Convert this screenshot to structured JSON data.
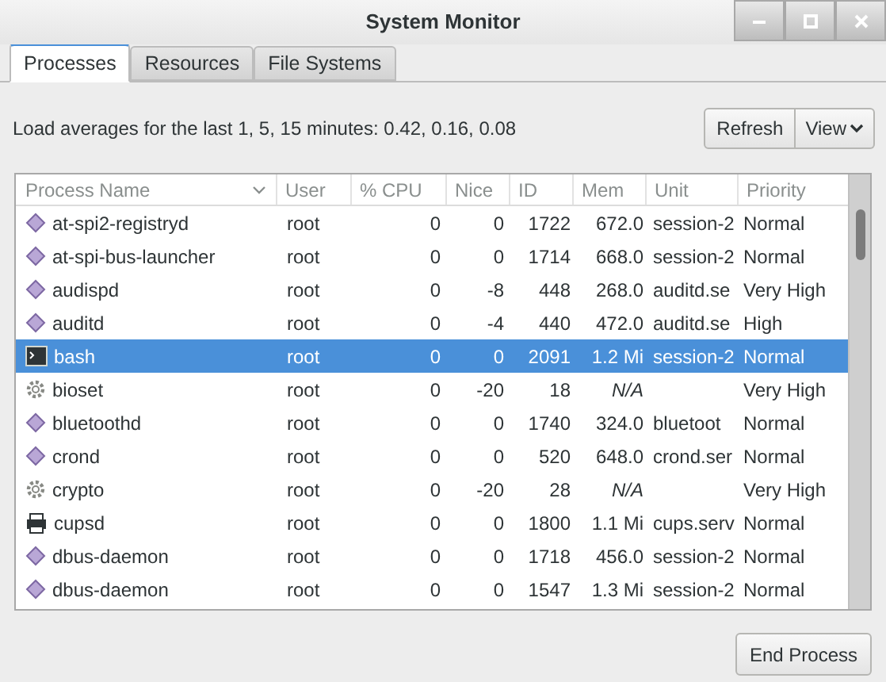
{
  "window": {
    "title": "System Monitor"
  },
  "tabs": [
    {
      "label": "Processes",
      "selected": true
    },
    {
      "label": "Resources",
      "selected": false
    },
    {
      "label": "File Systems",
      "selected": false
    }
  ],
  "load_averages": "Load averages for the last 1, 5, 15 minutes: 0.42, 0.16, 0.08",
  "buttons": {
    "refresh": "Refresh",
    "view": "View",
    "end_process": "End Process"
  },
  "table": {
    "columns": [
      "Process Name",
      "User",
      "% CPU",
      "Nice",
      "ID",
      "Mem",
      "Unit",
      "Priority"
    ],
    "rows": [
      {
        "kind": "daemon",
        "selected": false,
        "cells": [
          "at-spi2-registryd",
          "root",
          "0",
          "0",
          "1722",
          "672.0",
          "session-2",
          "Normal"
        ]
      },
      {
        "kind": "daemon",
        "selected": false,
        "cells": [
          "at-spi-bus-launcher",
          "root",
          "0",
          "0",
          "1714",
          "668.0",
          "session-2",
          "Normal"
        ]
      },
      {
        "kind": "daemon",
        "selected": false,
        "cells": [
          "audispd",
          "root",
          "0",
          "-8",
          "448",
          "268.0",
          "auditd.se",
          "Very High"
        ]
      },
      {
        "kind": "daemon",
        "selected": false,
        "cells": [
          "auditd",
          "root",
          "0",
          "-4",
          "440",
          "472.0",
          "auditd.se",
          "High"
        ]
      },
      {
        "kind": "terminal",
        "selected": true,
        "cells": [
          "bash",
          "root",
          "0",
          "0",
          "2091",
          "1.2 Mi",
          "session-2",
          "Normal"
        ]
      },
      {
        "kind": "kernel",
        "selected": false,
        "cells": [
          "bioset",
          "root",
          "0",
          "-20",
          "18",
          "N/A",
          "",
          "Very High"
        ]
      },
      {
        "kind": "daemon",
        "selected": false,
        "cells": [
          "bluetoothd",
          "root",
          "0",
          "0",
          "1740",
          "324.0",
          "bluetoot",
          "Normal"
        ]
      },
      {
        "kind": "daemon",
        "selected": false,
        "cells": [
          "crond",
          "root",
          "0",
          "0",
          "520",
          "648.0",
          "crond.ser",
          "Normal"
        ]
      },
      {
        "kind": "kernel",
        "selected": false,
        "cells": [
          "crypto",
          "root",
          "0",
          "-20",
          "28",
          "N/A",
          "",
          "Very High"
        ]
      },
      {
        "kind": "printer",
        "selected": false,
        "cells": [
          "cupsd",
          "root",
          "0",
          "0",
          "1800",
          "1.1 Mi",
          "cups.serv",
          "Normal"
        ]
      },
      {
        "kind": "daemon",
        "selected": false,
        "cells": [
          "dbus-daemon",
          "root",
          "0",
          "0",
          "1718",
          "456.0",
          "session-2",
          "Normal"
        ]
      },
      {
        "kind": "daemon",
        "selected": false,
        "cells": [
          "dbus-daemon",
          "root",
          "0",
          "0",
          "1547",
          "1.3 Mi",
          "session-2",
          "Normal"
        ]
      }
    ]
  }
}
